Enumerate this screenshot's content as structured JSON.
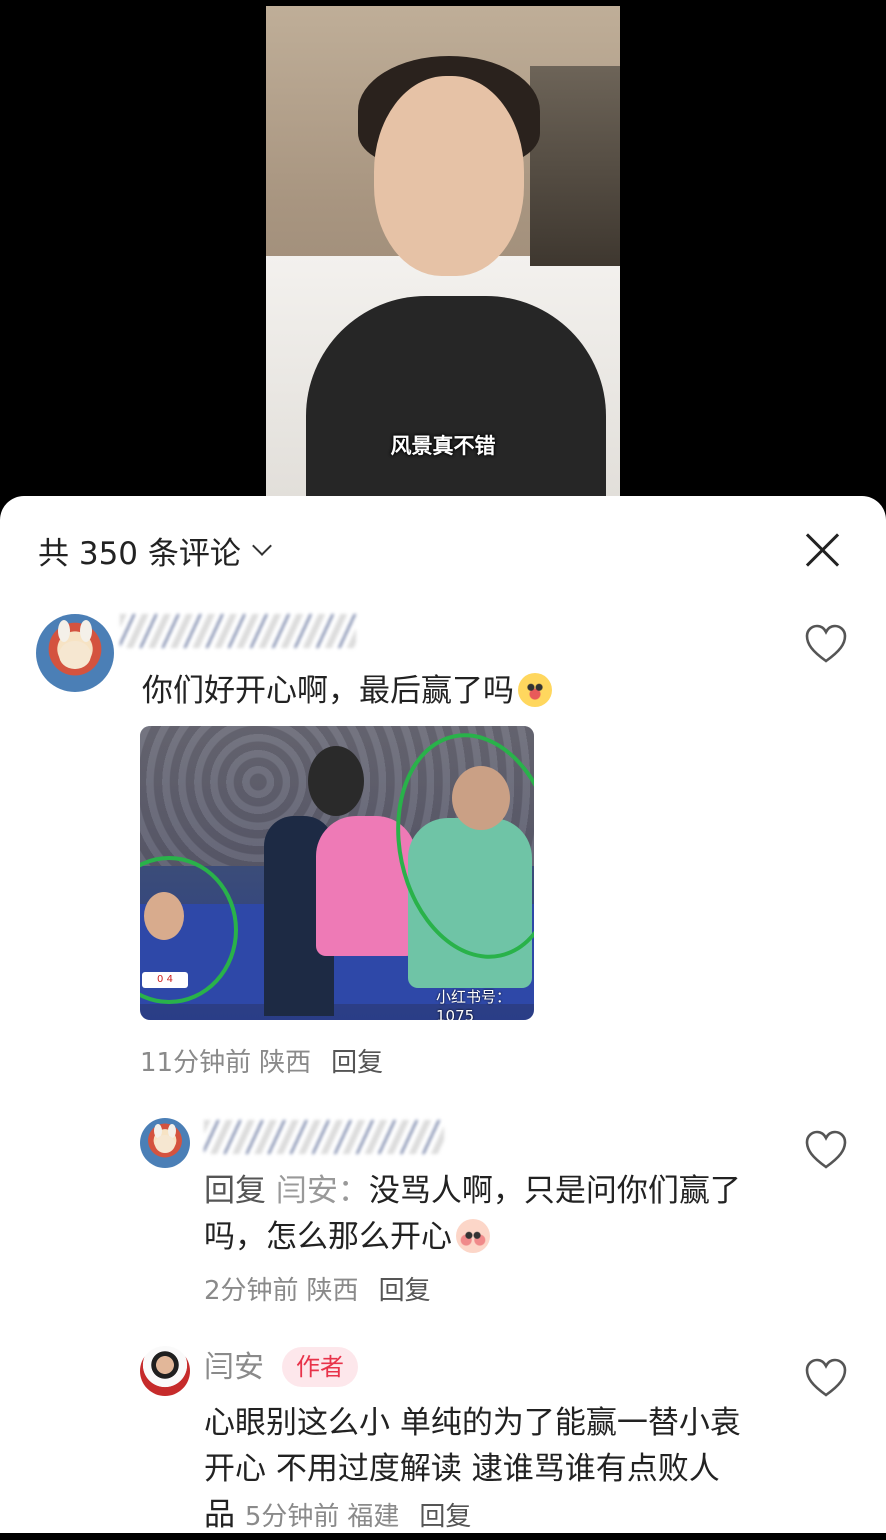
{
  "video": {
    "caption": "风景真不错"
  },
  "comments_panel": {
    "count_label": "共 350 条评论",
    "comments": [
      {
        "text": "你们好开心啊，最后赢了吗",
        "time": "11分钟前",
        "location": "陕西",
        "reply_label": "回复"
      },
      {
        "reply_prefix": "回复",
        "reply_target": "闫安：",
        "text": "没骂人啊，只是问你们赢了吗，怎么那么开心",
        "time": "2分钟前",
        "location": "陕西",
        "reply_label": "回复"
      },
      {
        "author": "闫安",
        "badge": "作者",
        "text": "心眼别这么小 单纯的为了能赢一替小袁开心 不用过度解读 逮谁骂谁有点败人品",
        "time": "5分钟前",
        "location": "福建",
        "reply_label": "回复"
      }
    ],
    "image_watermark": "小红书号：1075",
    "image_score": "0 4"
  },
  "icons": [
    "chevron-down-icon",
    "close-icon",
    "heart-icon",
    "emoji-icon"
  ],
  "colors": {
    "author_badge_text": "#e8334a",
    "author_badge_bg": "#fde7eb",
    "meta_text": "#8a8a8a",
    "annotation_circle": "#29b24a"
  }
}
